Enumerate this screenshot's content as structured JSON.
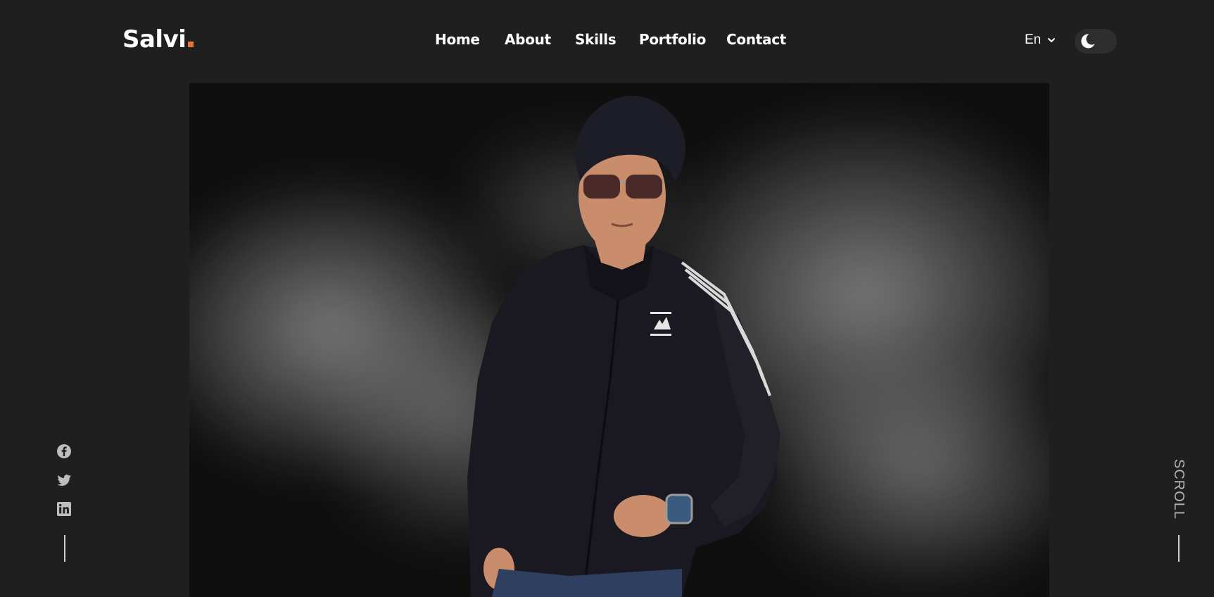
{
  "header": {
    "logo_text": "Salvi",
    "logo_accent_color": "#e8762d",
    "nav": {
      "home": "Home",
      "about": "About",
      "skills": "Skills",
      "portfolio": "Portfolio",
      "contact": "Contact"
    },
    "language": {
      "selected": "En",
      "icon": "chevron-down-icon"
    },
    "theme_toggle": {
      "icon": "moon-icon",
      "mode": "dark"
    }
  },
  "hero": {
    "image_subject": "person-photo",
    "brand_logo_on_jacket": "adidas"
  },
  "social": {
    "icons": [
      "facebook-icon",
      "twitter-icon",
      "linkedin-icon"
    ]
  },
  "scroll_indicator": {
    "label": "SCROLL"
  },
  "colors": {
    "background": "#1f1f1f",
    "text": "#ffffff",
    "accent": "#e8762d",
    "muted": "#b5b5b5"
  }
}
